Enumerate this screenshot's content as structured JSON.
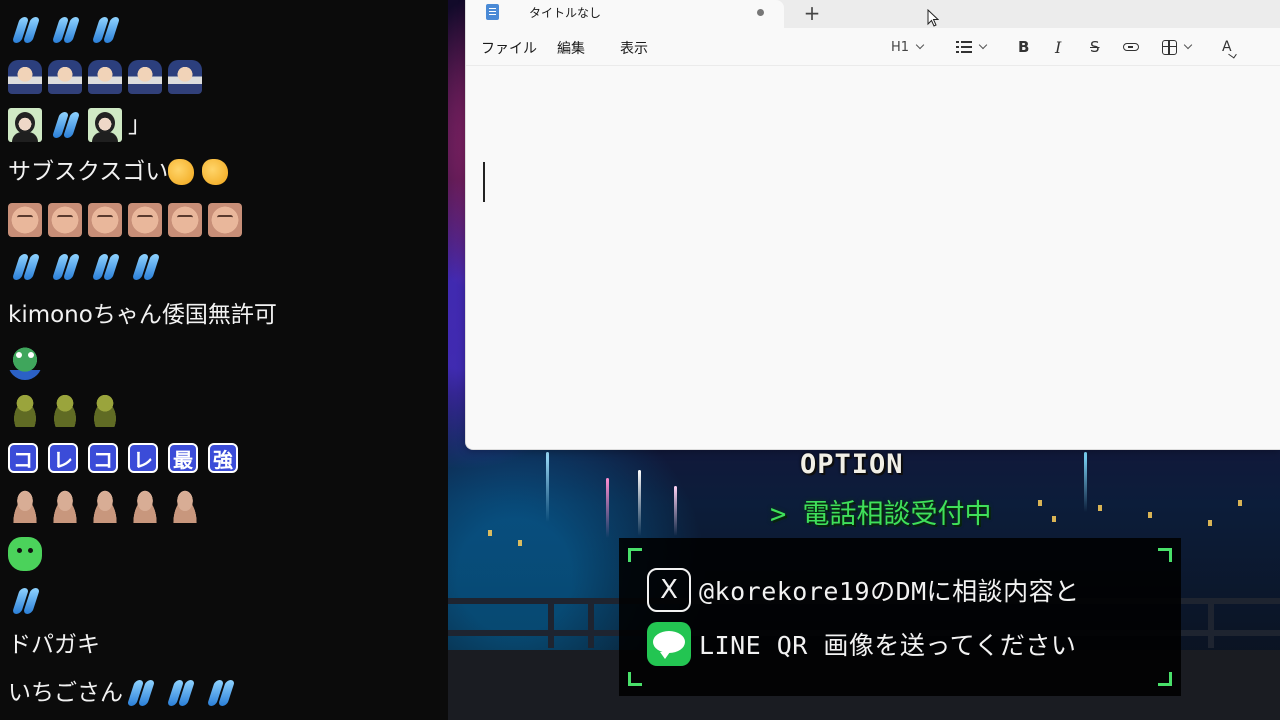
{
  "chat": {
    "messages": [
      {
        "emotes": [
          "wave",
          "wave",
          "wave"
        ],
        "text": ""
      },
      {
        "emotes": [
          "ninja",
          "ninja",
          "ninja",
          "ninja",
          "ninja"
        ],
        "text": ""
      },
      {
        "emotes": [
          "avatar",
          "wave",
          "avatar"
        ],
        "text": "」"
      },
      {
        "emotes": [],
        "text": "サブスクスゴい",
        "trailing_emotes": [
          "clap",
          "clap"
        ]
      },
      {
        "emotes": [
          "face",
          "face",
          "face",
          "face",
          "face",
          "face"
        ],
        "text": ""
      },
      {
        "emotes": [
          "wave",
          "wave",
          "wave",
          "wave"
        ],
        "text": ""
      },
      {
        "emotes": [],
        "text": "kimonoちゃん倭国無許可"
      },
      {
        "emotes": [
          "frog"
        ],
        "text": ""
      },
      {
        "emotes": [
          "turtle",
          "turtle",
          "turtle"
        ],
        "text": ""
      },
      {
        "emotes": [],
        "kana_emotes": [
          "コ",
          "レ",
          "コ",
          "レ",
          "最",
          "強"
        ],
        "text": ""
      },
      {
        "emotes": [
          "bald",
          "bald",
          "bald",
          "bald",
          "bald"
        ],
        "text": ""
      },
      {
        "emotes": [
          "blob"
        ],
        "text": ""
      },
      {
        "emotes": [
          "wave"
        ],
        "text": ""
      },
      {
        "emotes": [],
        "text": "ドパガキ"
      },
      {
        "emotes": [],
        "text": "いちごさん",
        "trailing_emotes": [
          "wave",
          "wave",
          "wave"
        ]
      }
    ]
  },
  "notepad": {
    "tab_title": "タイトルなし",
    "tab_unsaved_dot": "●",
    "new_tab_symbol": "+",
    "menu": {
      "file": "ファイル",
      "edit": "編集",
      "view": "表示"
    },
    "toolbar": {
      "heading": "H1",
      "bold": "B",
      "italic": "I",
      "strike": "S",
      "spell": "A"
    },
    "editor_text": ""
  },
  "overlay": {
    "option_title": "OPTION",
    "phone_line": "> 電話相談受付中",
    "x_logo_glyph": "X",
    "contact_line_1": "@korekore19のDMに相談内容と",
    "contact_line_2": "LINE QR 画像を送ってください",
    "accent_color": "#49e06a"
  }
}
